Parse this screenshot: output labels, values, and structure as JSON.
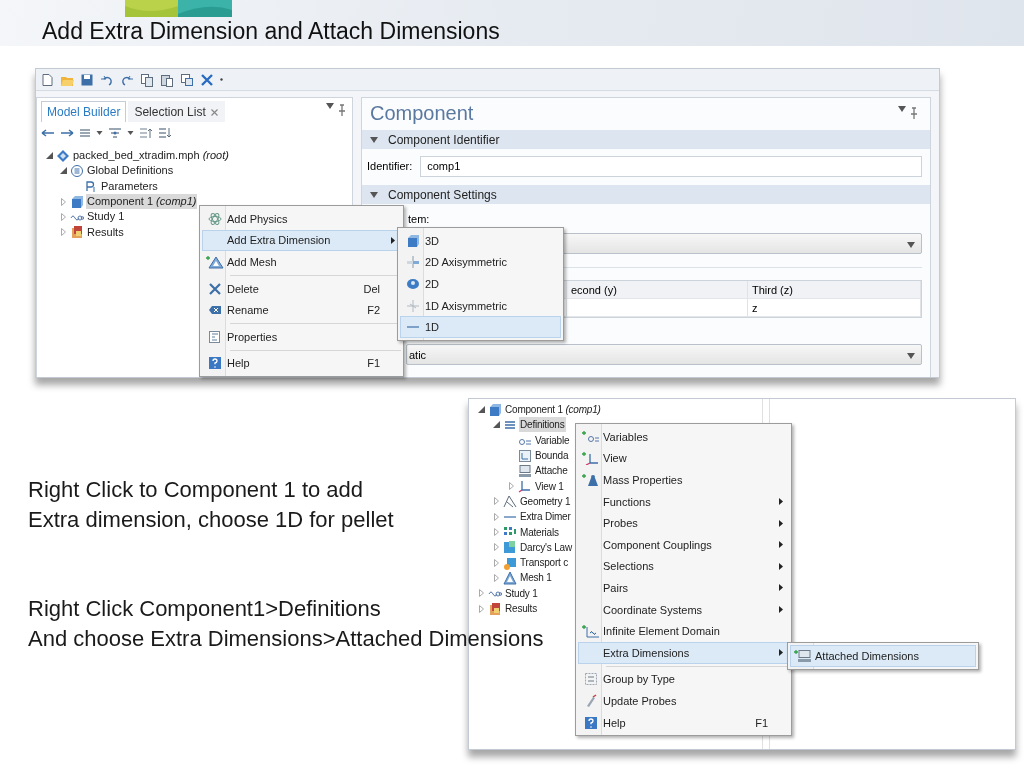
{
  "slide": {
    "title": "Add Extra Dimension and Attach Dimensions"
  },
  "app_1": {
    "panel_tabs": [
      {
        "label": "Model Builder",
        "selected": true,
        "closable": false
      },
      {
        "label": "Selection List",
        "selected": false,
        "closable": true
      }
    ],
    "tree": [
      {
        "label": "packed_bed_xtradim.mph *(root)*",
        "expanded": true,
        "selected": false,
        "children": [
          {
            "label": "Global Definitions",
            "expanded": true,
            "selected": false,
            "children": [
              {
                "label": "Parameters",
                "selected": false
              }
            ]
          },
          {
            "label": "Component 1 *(comp1)*",
            "expanded": false,
            "selected": true
          },
          {
            "label": "Study 1",
            "expanded": false,
            "selected": false
          },
          {
            "label": "Results",
            "expanded": false,
            "selected": false
          }
        ]
      }
    ],
    "settings": {
      "title": "Component",
      "identifier_section": {
        "title": "Component Identifier",
        "expanded": true
      },
      "identifier": {
        "label": "Identifier:",
        "value": "comp1"
      },
      "settings_section": {
        "title": "Component Settings",
        "expanded": true
      },
      "partial_label": "tem:",
      "coordinate_table": {
        "second_header": "econd (y)",
        "third_header": "Third (z)",
        "third_value": "z"
      },
      "shape_select": {
        "value": "atic"
      }
    },
    "context_menu": {
      "groups": [
        [
          {
            "label": "Add Physics",
            "submenu": false,
            "selected": false
          },
          {
            "label": "Add Extra Dimension",
            "submenu": true,
            "selected": true
          },
          {
            "label": "Add Mesh",
            "submenu": false,
            "selected": false
          }
        ],
        [
          {
            "label": "Delete",
            "shortcut": "Del",
            "submenu": false,
            "selected": false
          },
          {
            "label": "Rename",
            "shortcut": "F2",
            "submenu": false,
            "selected": false
          }
        ],
        [
          {
            "label": "Properties",
            "submenu": false,
            "selected": false
          }
        ],
        [
          {
            "label": "Help",
            "shortcut": "F1",
            "submenu": false,
            "selected": false
          }
        ]
      ]
    },
    "submenu": {
      "groups": [
        [
          {
            "label": "3D",
            "submenu": false,
            "selected": false
          },
          {
            "label": "2D Axisymmetric",
            "submenu": false,
            "selected": false
          },
          {
            "label": "2D",
            "submenu": false,
            "selected": false
          },
          {
            "label": "1D Axisymmetric",
            "submenu": false,
            "selected": false
          },
          {
            "label": "1D",
            "submenu": false,
            "selected": true
          }
        ]
      ]
    }
  },
  "notes": [
    [
      "Right Click to Component 1 to add",
      "Extra dimension, choose 1D for pellet"
    ],
    [
      "Right Click Component1>Definitions",
      "And choose Extra Dimensions>Attached Dimensions"
    ]
  ],
  "app_2": {
    "tree": [
      {
        "label": "Component 1 *(comp1)*",
        "expanded": true,
        "selected": false,
        "children": [
          {
            "label": "Definitions",
            "expanded": true,
            "selected": true,
            "children": [
              {
                "label": "Variable",
                "selected": false
              },
              {
                "label": "Bounda",
                "selected": false
              },
              {
                "label": "Attache",
                "selected": false
              },
              {
                "label": "View 1",
                "expanded": false,
                "selected": false
              }
            ]
          },
          {
            "label": "Geometry 1",
            "expanded": false,
            "selected": false
          },
          {
            "label": "Extra Dimer",
            "expanded": false,
            "selected": false
          },
          {
            "label": "Materials",
            "expanded": false,
            "selected": false
          },
          {
            "label": "Darcy's Law",
            "expanded": false,
            "selected": false
          },
          {
            "label": "Transport c",
            "expanded": false,
            "selected": false
          },
          {
            "label": "Mesh 1",
            "expanded": false,
            "selected": false
          }
        ]
      },
      {
        "label": "Study 1",
        "expanded": false,
        "selected": false
      },
      {
        "label": "Results",
        "expanded": false,
        "selected": false
      }
    ],
    "context_menu": {
      "groups": [
        [
          {
            "label": "Variables",
            "submenu": false,
            "selected": false
          },
          {
            "label": "View",
            "submenu": false,
            "selected": false
          },
          {
            "label": "Mass Properties",
            "submenu": false,
            "selected": false
          },
          {
            "label": "Functions",
            "submenu": true,
            "selected": false
          },
          {
            "label": "Probes",
            "submenu": true,
            "selected": false
          },
          {
            "label": "Component Couplings",
            "submenu": true,
            "selected": false
          },
          {
            "label": "Selections",
            "submenu": true,
            "selected": false
          },
          {
            "label": "Pairs",
            "submenu": true,
            "selected": false
          },
          {
            "label": "Coordinate Systems",
            "submenu": true,
            "selected": false
          },
          {
            "label": "Infinite Element Domain",
            "submenu": false,
            "selected": false
          },
          {
            "label": "Extra Dimensions",
            "submenu": true,
            "selected": true
          }
        ],
        [
          {
            "label": "Group by Type",
            "submenu": false,
            "selected": false
          },
          {
            "label": "Update Probes",
            "submenu": false,
            "selected": false
          },
          {
            "label": "Help",
            "shortcut": "F1",
            "submenu": false,
            "selected": false
          }
        ]
      ]
    },
    "submenu": {
      "groups": [
        [
          {
            "label": "Attached Dimensions",
            "submenu": false,
            "selected": true
          }
        ]
      ]
    }
  }
}
